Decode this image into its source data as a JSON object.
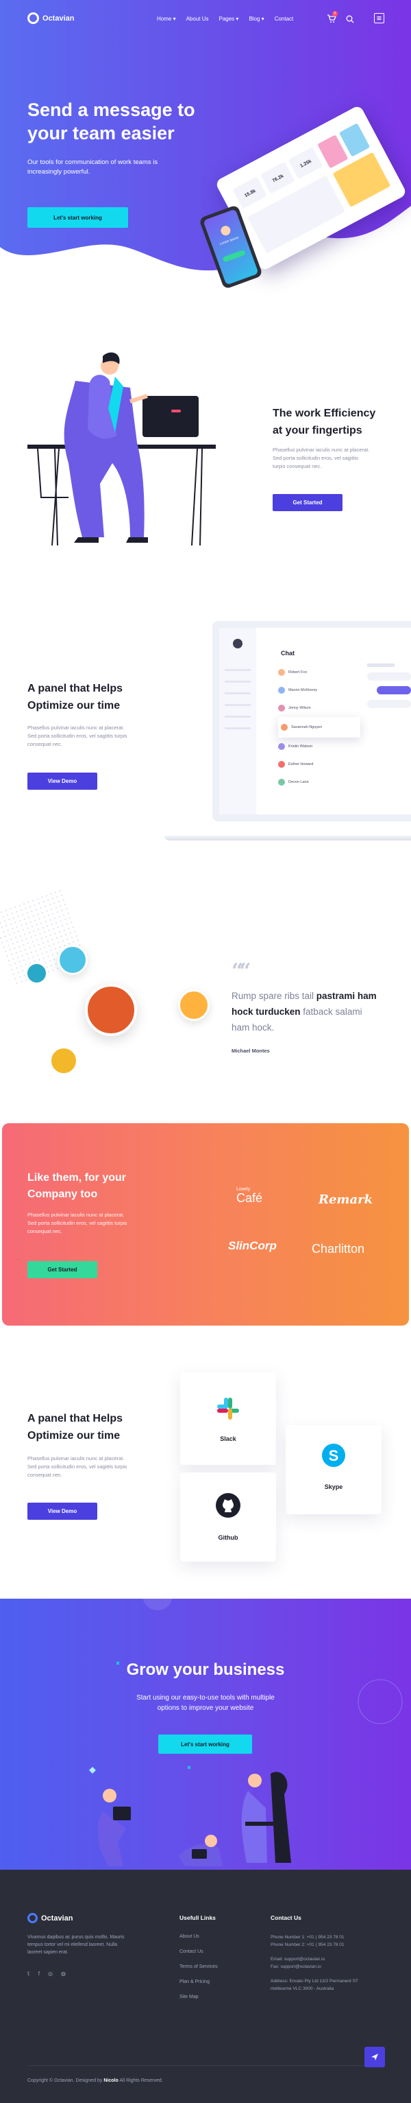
{
  "colors": {
    "primary": "#4b3fe0",
    "cyan": "#12d9ee",
    "green": "#33d89a",
    "orange": "#f6933f",
    "footer": "#2b2d38"
  },
  "header": {
    "logo_text": "Octavian",
    "nav": [
      {
        "label": "Home"
      },
      {
        "label": "About Us"
      },
      {
        "label": "Pages"
      },
      {
        "label": "Blog"
      },
      {
        "label": "Contact"
      }
    ],
    "cart_badge": "0"
  },
  "hero": {
    "title_line1": "Send a message to",
    "title_line2": "your team easier",
    "subtitle_line1": "Our tools for communication of work teams is",
    "subtitle_line2": "increasingly powerful.",
    "cta": "Let's start working",
    "dashboard": {
      "stat1": "15.8k",
      "stat2": "76.2k",
      "stat3": "1.25k"
    },
    "phone": {
      "name": "Lorem Ipsum"
    }
  },
  "efficiency": {
    "title_line1": "The work Efficiency",
    "title_line2": "at your fingertips",
    "text_line1": "Phasellus pulvinar iaculis nunc at placerat.",
    "text_line2": "Sed porta sollicitudin eros, vel sagittis",
    "text_line3": "turpis consequat nec.",
    "cta": "Get Started"
  },
  "panel": {
    "title_line1": "A panel that Helps",
    "title_line2": "Optimize our time",
    "text_line1": "Phasellus pulvinar iaculis nunc at placerat.",
    "text_line2": "Sed porta sollicitudin eros, vel sagittis turpis",
    "text_line3": "consequat nec.",
    "cta": "View Demo",
    "chat_title": "Chat",
    "contacts": [
      "Robert Fox",
      "Marvin McKinney",
      "Jenny Wilson",
      "Savannah Nguyen",
      "Kristin Watson",
      "Esther Howard",
      "Devon Lane"
    ]
  },
  "testimonial": {
    "quote_mark": "““",
    "line1_a": "Rump spare ribs tail ",
    "line1_b": "pastrami ham",
    "line2_a": "hock turducken",
    "line2_b": " fatback salami",
    "line3": "ham hock.",
    "author": "Michael Montes"
  },
  "clients": {
    "title_line1": "Like them, for your",
    "title_line2": "Company too",
    "text_line1": "Phasellus pulvinar iaculis nunc at placerat.",
    "text_line2": "Sed porta sollicitudin eros, vel sagittis turpis",
    "text_line3": "consequat nec.",
    "cta": "Get Started",
    "logos": {
      "lovely": "Lovely",
      "cafe": "Café",
      "remark": "Remark",
      "slincorp": "SlinCorp",
      "charlitton": "Charlitton"
    }
  },
  "integrations": {
    "title_line1": "A panel that Helps",
    "title_line2": "Optimize our time",
    "text_line1": "Phasellus pulvinar iaculis nunc at placerat.",
    "text_line2": "Sed porta sollicitudin eros, vel sagittis turpis",
    "text_line3": "consequat nec.",
    "cta": "View Demo",
    "apps": {
      "slack": "Slack",
      "skype": "Skype",
      "github": "Github"
    }
  },
  "grow": {
    "title": "Grow your business",
    "text_line1": "Start using our easy-to-use tools with multiple",
    "text_line2": "options to improve your website",
    "cta": "Let's start working"
  },
  "footer": {
    "logo_text": "Octavian",
    "about_line1": "Vivamus dapibus ac purus quis mollis. Mauris",
    "about_line2": "tempus tortor vel mi eleifend laoreet. Nulla",
    "about_line3": "laoreet sapien erat.",
    "links_title": "Usefull Links",
    "links": [
      {
        "label": "About Us"
      },
      {
        "label": "Contact Us"
      },
      {
        "label": "Terms of Services"
      },
      {
        "label": "Plan & Pricing"
      },
      {
        "label": "Site Map"
      }
    ],
    "contact_title": "Contact Us",
    "phone1": "Phone Number 1: +01 ( 954 23 78 01",
    "phone2": "Phone Number 2: +01 ( 954 23 78 01",
    "email": "Email: support@octavian.io",
    "fax": "Fax: support@octavian.io",
    "address1": "Address: Envato Pty Ltd 13/2 Permanent ST",
    "address2": "melbourne VLC 3000 - Australia",
    "copyright_a": "Copyright © Octavian. Designed by ",
    "copyright_b": "Nicolo",
    "copyright_c": " All Rights Reserved."
  }
}
